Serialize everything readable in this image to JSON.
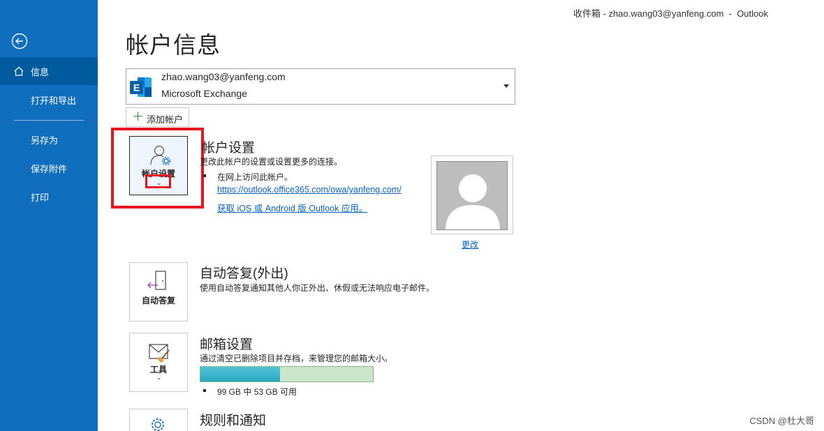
{
  "titlebar": {
    "text": "收件箱 - zhao.wang03@yanfeng.com  -  Outlook"
  },
  "sidebar": {
    "items": [
      {
        "label": "信息"
      },
      {
        "label": "打开和导出"
      },
      {
        "label": "另存为"
      },
      {
        "label": "保存附件"
      },
      {
        "label": "打印"
      }
    ]
  },
  "page": {
    "title": "帐户信息"
  },
  "account": {
    "email": "zhao.wang03@yanfeng.com",
    "type": "Microsoft Exchange",
    "icon": "exchange-icon"
  },
  "add_account": {
    "label": "添加帐户"
  },
  "account_settings": {
    "tile_label": "帐户设置",
    "title": "帐户设置",
    "desc": "更改此帐户的设置或设置更多的连接。",
    "bullet": "在网上访问此帐户。",
    "link1": "https://outlook.office365.com/owa/yanfeng.com/",
    "link2": "获取 iOS 或 Android 版 Outlook 应用。",
    "change_photo": "更改"
  },
  "auto_reply": {
    "tile_label": "自动答复",
    "title": "自动答复(外出)",
    "desc": "使用自动答复通知其他人你正外出、休假或无法响应电子邮件。"
  },
  "mailbox": {
    "tile_label": "工具",
    "title": "邮箱设置",
    "desc": "通过清空已删除项目并存档，来管理您的邮箱大小。",
    "usage_text": "99 GB 中 53 GB 可用",
    "used_fraction": 0.46
  },
  "rules": {
    "title": "规则和通知"
  },
  "watermark": {
    "text": "CSDN @杜大哥"
  },
  "colors": {
    "sidebar": "#106ebe",
    "sidebar_active": "#005a9e",
    "highlight": "#e8121f",
    "link": "#0563c1"
  }
}
